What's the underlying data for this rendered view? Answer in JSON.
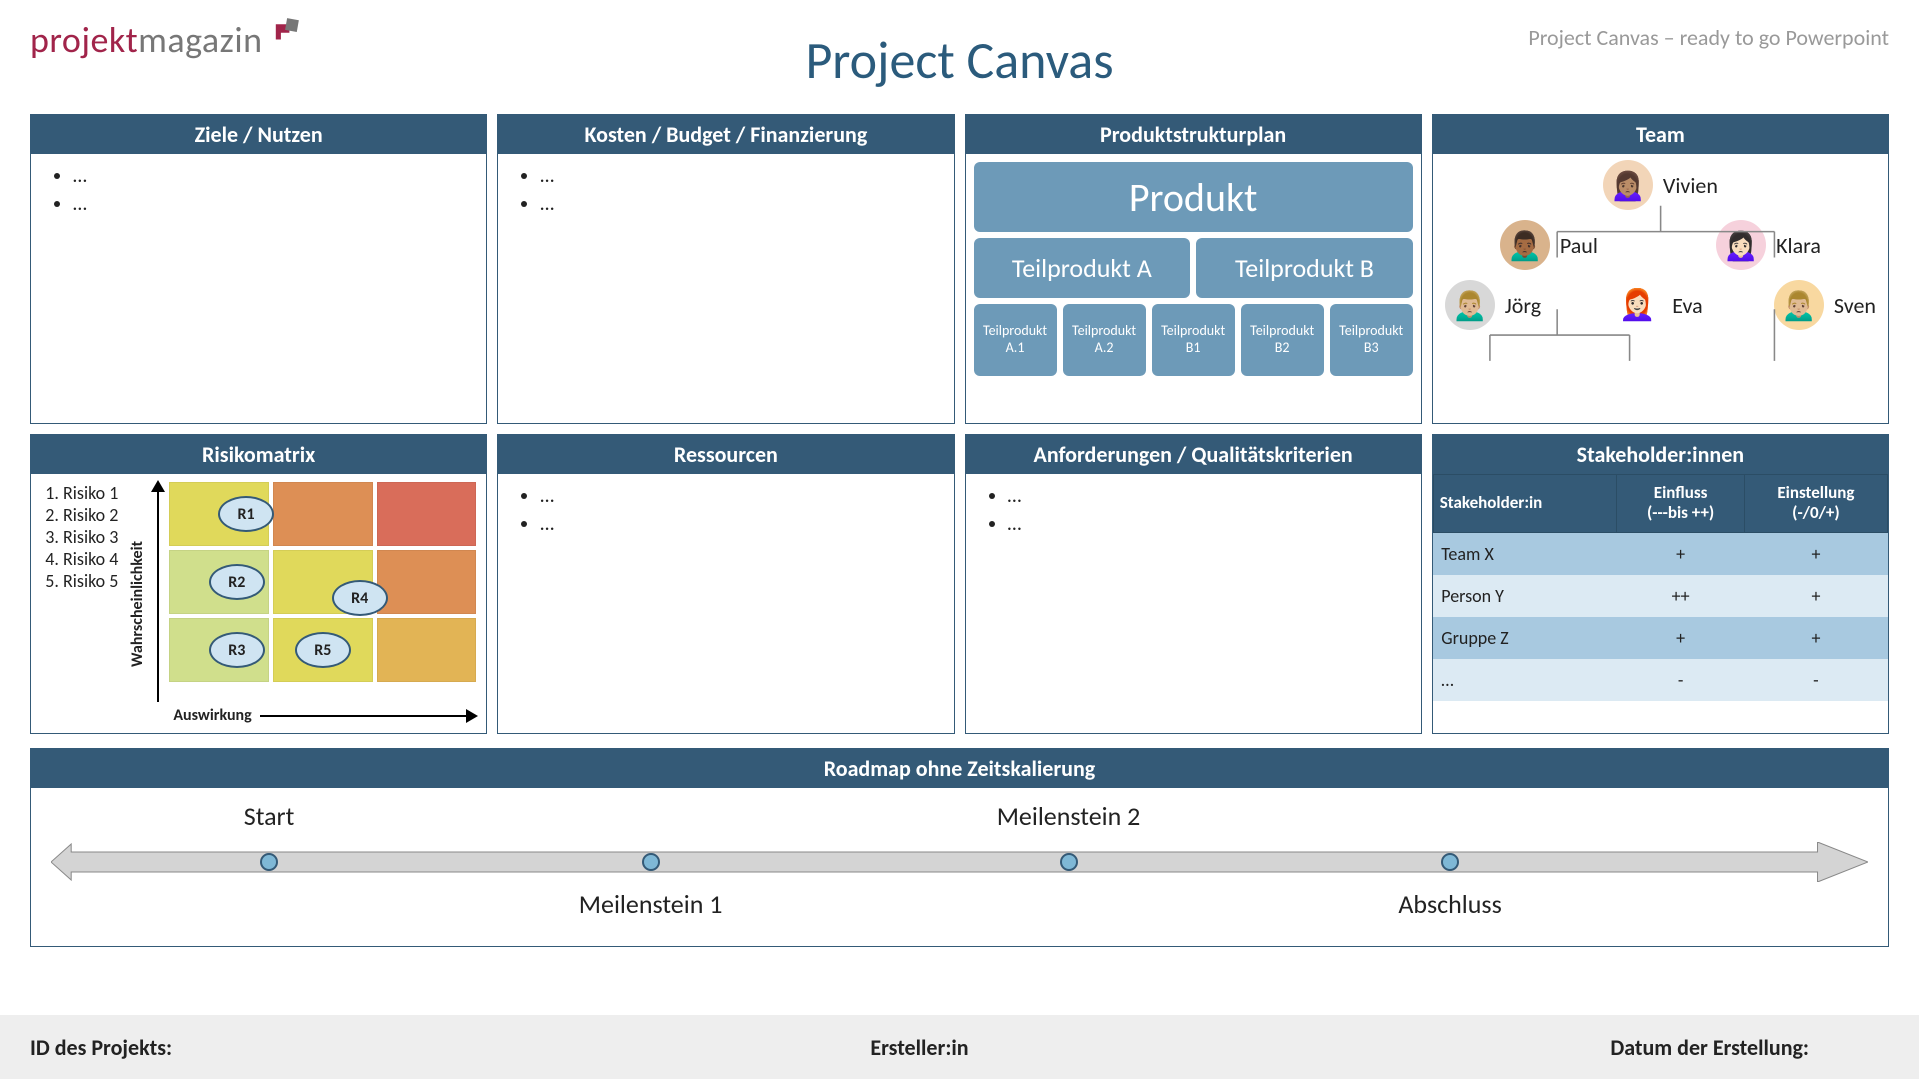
{
  "branding": {
    "part1": "projekt",
    "part2": "magazin"
  },
  "title": "Project Canvas",
  "subtitle": "Project Canvas – ready to go Powerpoint",
  "panels": {
    "ziele": {
      "title": "Ziele / Nutzen",
      "items": [
        "…",
        "…"
      ]
    },
    "kosten": {
      "title": "Kosten / Budget / Finanzierung",
      "items": [
        "…",
        "…"
      ]
    },
    "psp": {
      "title": "Produktstrukturplan",
      "root": "Produkt",
      "mids": [
        "Teilprodukt A",
        "Teilprodukt B"
      ],
      "leaves": [
        "Teilprodukt A.1",
        "Teilprodukt A.2",
        "Teilprodukt B1",
        "Teilprodukt B2",
        "Teilprodukt B3"
      ]
    },
    "team": {
      "title": "Team",
      "people": {
        "top": "Vivien",
        "mid": [
          "Paul",
          "Klara"
        ],
        "bottom": [
          "Jörg",
          "Eva",
          "Sven"
        ]
      }
    },
    "risiko": {
      "title": "Risikomatrix",
      "list": [
        "Risiko 1",
        "Risiko 2",
        "Risiko 3",
        "Risiko 4",
        "Risiko 5"
      ],
      "ylabel": "Wahrscheinlichkeit",
      "xlabel": "Auswirkung",
      "bubbles": [
        {
          "id": "R1",
          "x": 25,
          "y": 16
        },
        {
          "id": "R2",
          "x": 22,
          "y": 50
        },
        {
          "id": "R4",
          "x": 62,
          "y": 58
        },
        {
          "id": "R3",
          "x": 22,
          "y": 84
        },
        {
          "id": "R5",
          "x": 50,
          "y": 84
        }
      ]
    },
    "ressourcen": {
      "title": "Ressourcen",
      "items": [
        "…",
        "…"
      ]
    },
    "anforderungen": {
      "title": "Anforderungen / Qualitätskriterien",
      "items": [
        "…",
        "…"
      ]
    },
    "stakeholder": {
      "title": "Stakeholder:innen",
      "headers": [
        "Stakeholder:in",
        "Einfluss (---bis ++)",
        "Einstellung (-/0/+)"
      ],
      "rows": [
        [
          "Team X",
          "+",
          "+"
        ],
        [
          "Person Y",
          "++",
          "+"
        ],
        [
          "Gruppe Z",
          "+",
          "+"
        ],
        [
          "…",
          "-",
          "-"
        ]
      ]
    }
  },
  "roadmap": {
    "title": "Roadmap ohne Zeitskalierung",
    "milestones": [
      {
        "label": "Start",
        "pos": 12,
        "labelPos": "top"
      },
      {
        "label": "Meilenstein 1",
        "pos": 33,
        "labelPos": "bottom"
      },
      {
        "label": "Meilenstein 2",
        "pos": 56,
        "labelPos": "top"
      },
      {
        "label": "Abschluss",
        "pos": 77,
        "labelPos": "bottom"
      }
    ]
  },
  "footer": {
    "left": "ID des Projekts:",
    "center": "Ersteller:in",
    "right": "Datum der Erstellung:"
  }
}
